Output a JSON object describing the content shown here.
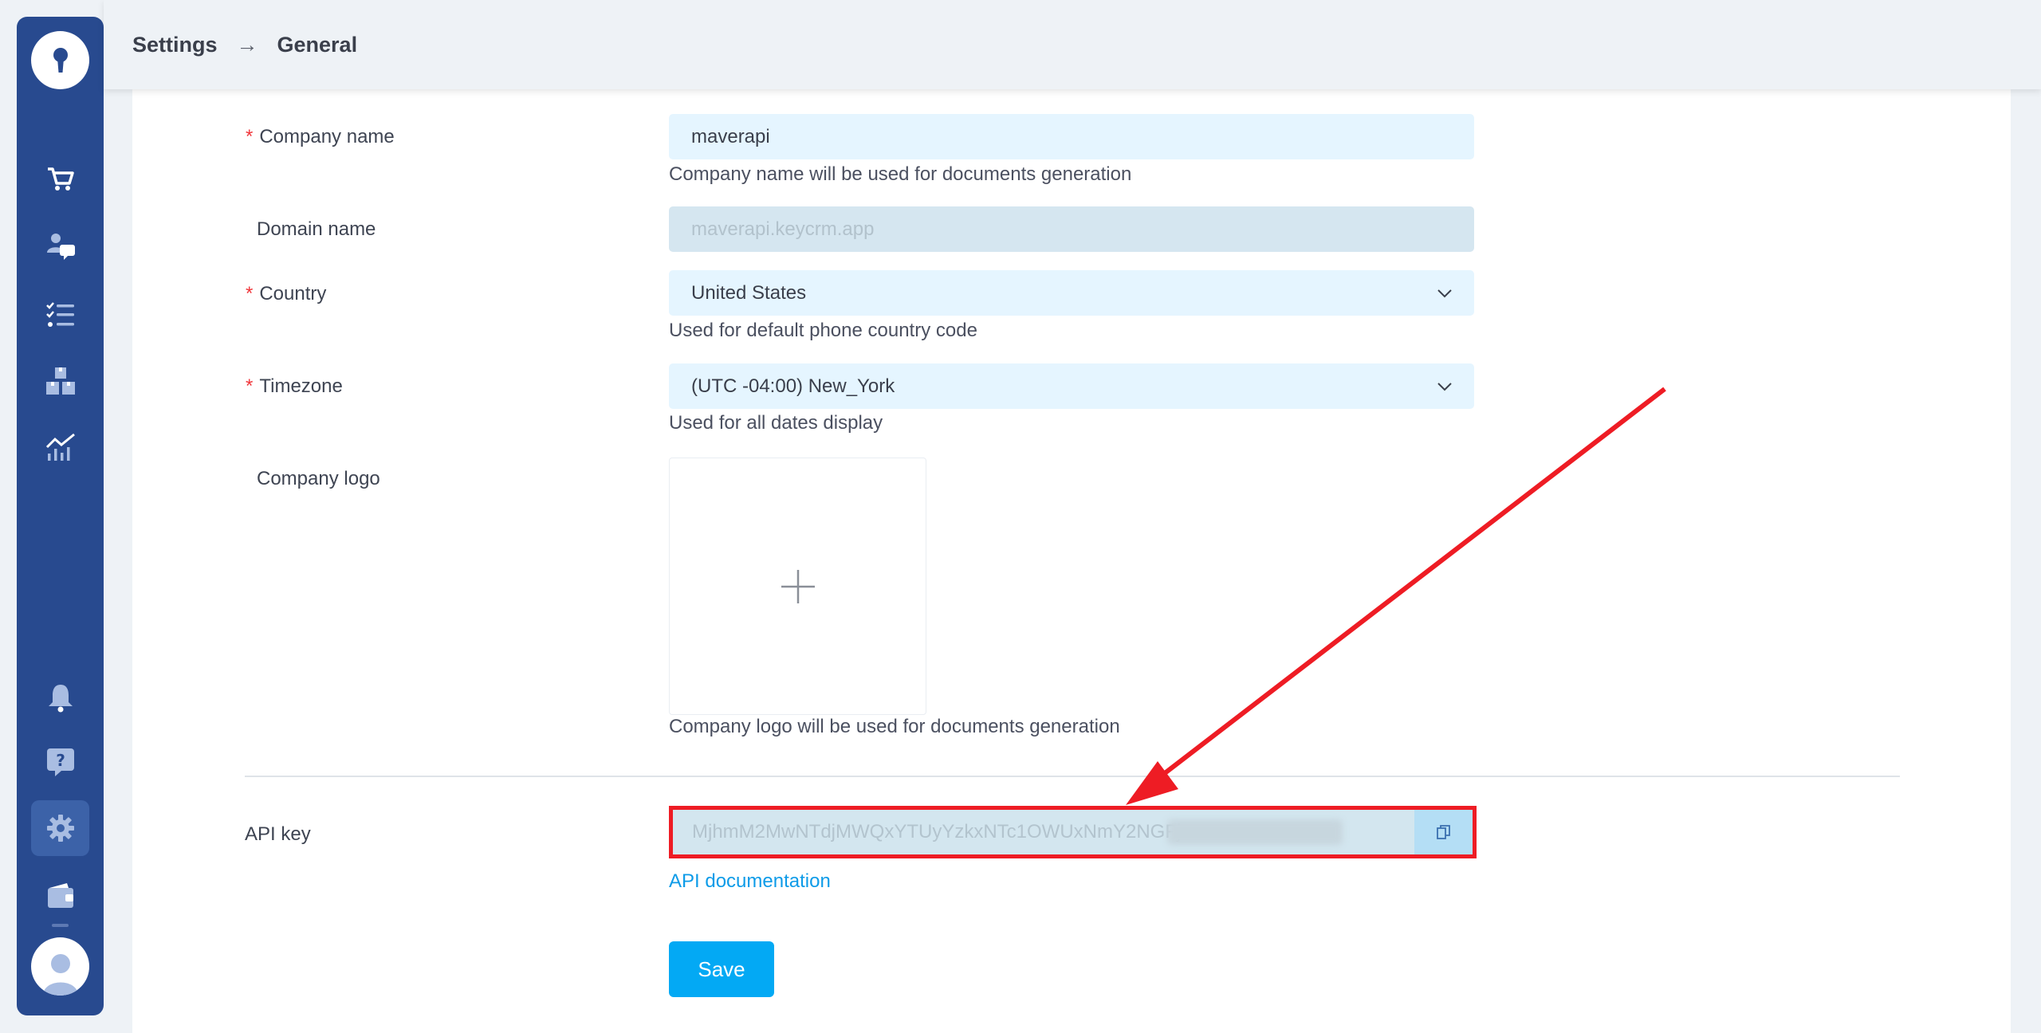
{
  "header": {
    "breadcrumb": [
      "Settings",
      "General"
    ],
    "separator": "→"
  },
  "sidebar": {
    "logo_icon": "keyhole-icon",
    "items": [
      {
        "name": "orders",
        "icon": "cart-icon",
        "active": false
      },
      {
        "name": "customers",
        "icon": "user-chat-icon",
        "active": false
      },
      {
        "name": "tasks",
        "icon": "checklist-icon",
        "active": false
      },
      {
        "name": "warehouse",
        "icon": "boxes-icon",
        "active": false
      },
      {
        "name": "analytics",
        "icon": "chart-icon",
        "active": false
      },
      {
        "name": "notifications",
        "icon": "bell-icon",
        "active": false
      },
      {
        "name": "help",
        "icon": "help-icon",
        "active": false
      },
      {
        "name": "settings",
        "icon": "gear-icon",
        "active": true
      },
      {
        "name": "wallet",
        "icon": "wallet-icon",
        "active": false
      }
    ],
    "avatar_icon": "user-avatar-icon"
  },
  "form": {
    "company_name": {
      "label": "Company name",
      "required": true,
      "value": "maverapi",
      "hint": "Company name will be used for documents generation"
    },
    "domain_name": {
      "label": "Domain name",
      "required": false,
      "value": "maverapi.keycrm.app"
    },
    "country": {
      "label": "Country",
      "required": true,
      "value": "United States",
      "hint": "Used for default phone country code"
    },
    "timezone": {
      "label": "Timezone",
      "required": true,
      "value": "(UTC -04:00) New_York",
      "hint": "Used for all dates display"
    },
    "company_logo": {
      "label": "Company logo",
      "hint": "Company logo will be used for documents generation"
    },
    "api_key": {
      "label": "API key",
      "value": "MjhmM2MwNTdjMWQxYTUyYzkxNTc1OWUxNmY2NGFj",
      "link": "API documentation"
    },
    "save_label": "Save"
  },
  "colors": {
    "sidebar": "#284a8f",
    "accent": "#03a9f4",
    "required": "#f0373c",
    "highlight": "#ee1c24"
  }
}
